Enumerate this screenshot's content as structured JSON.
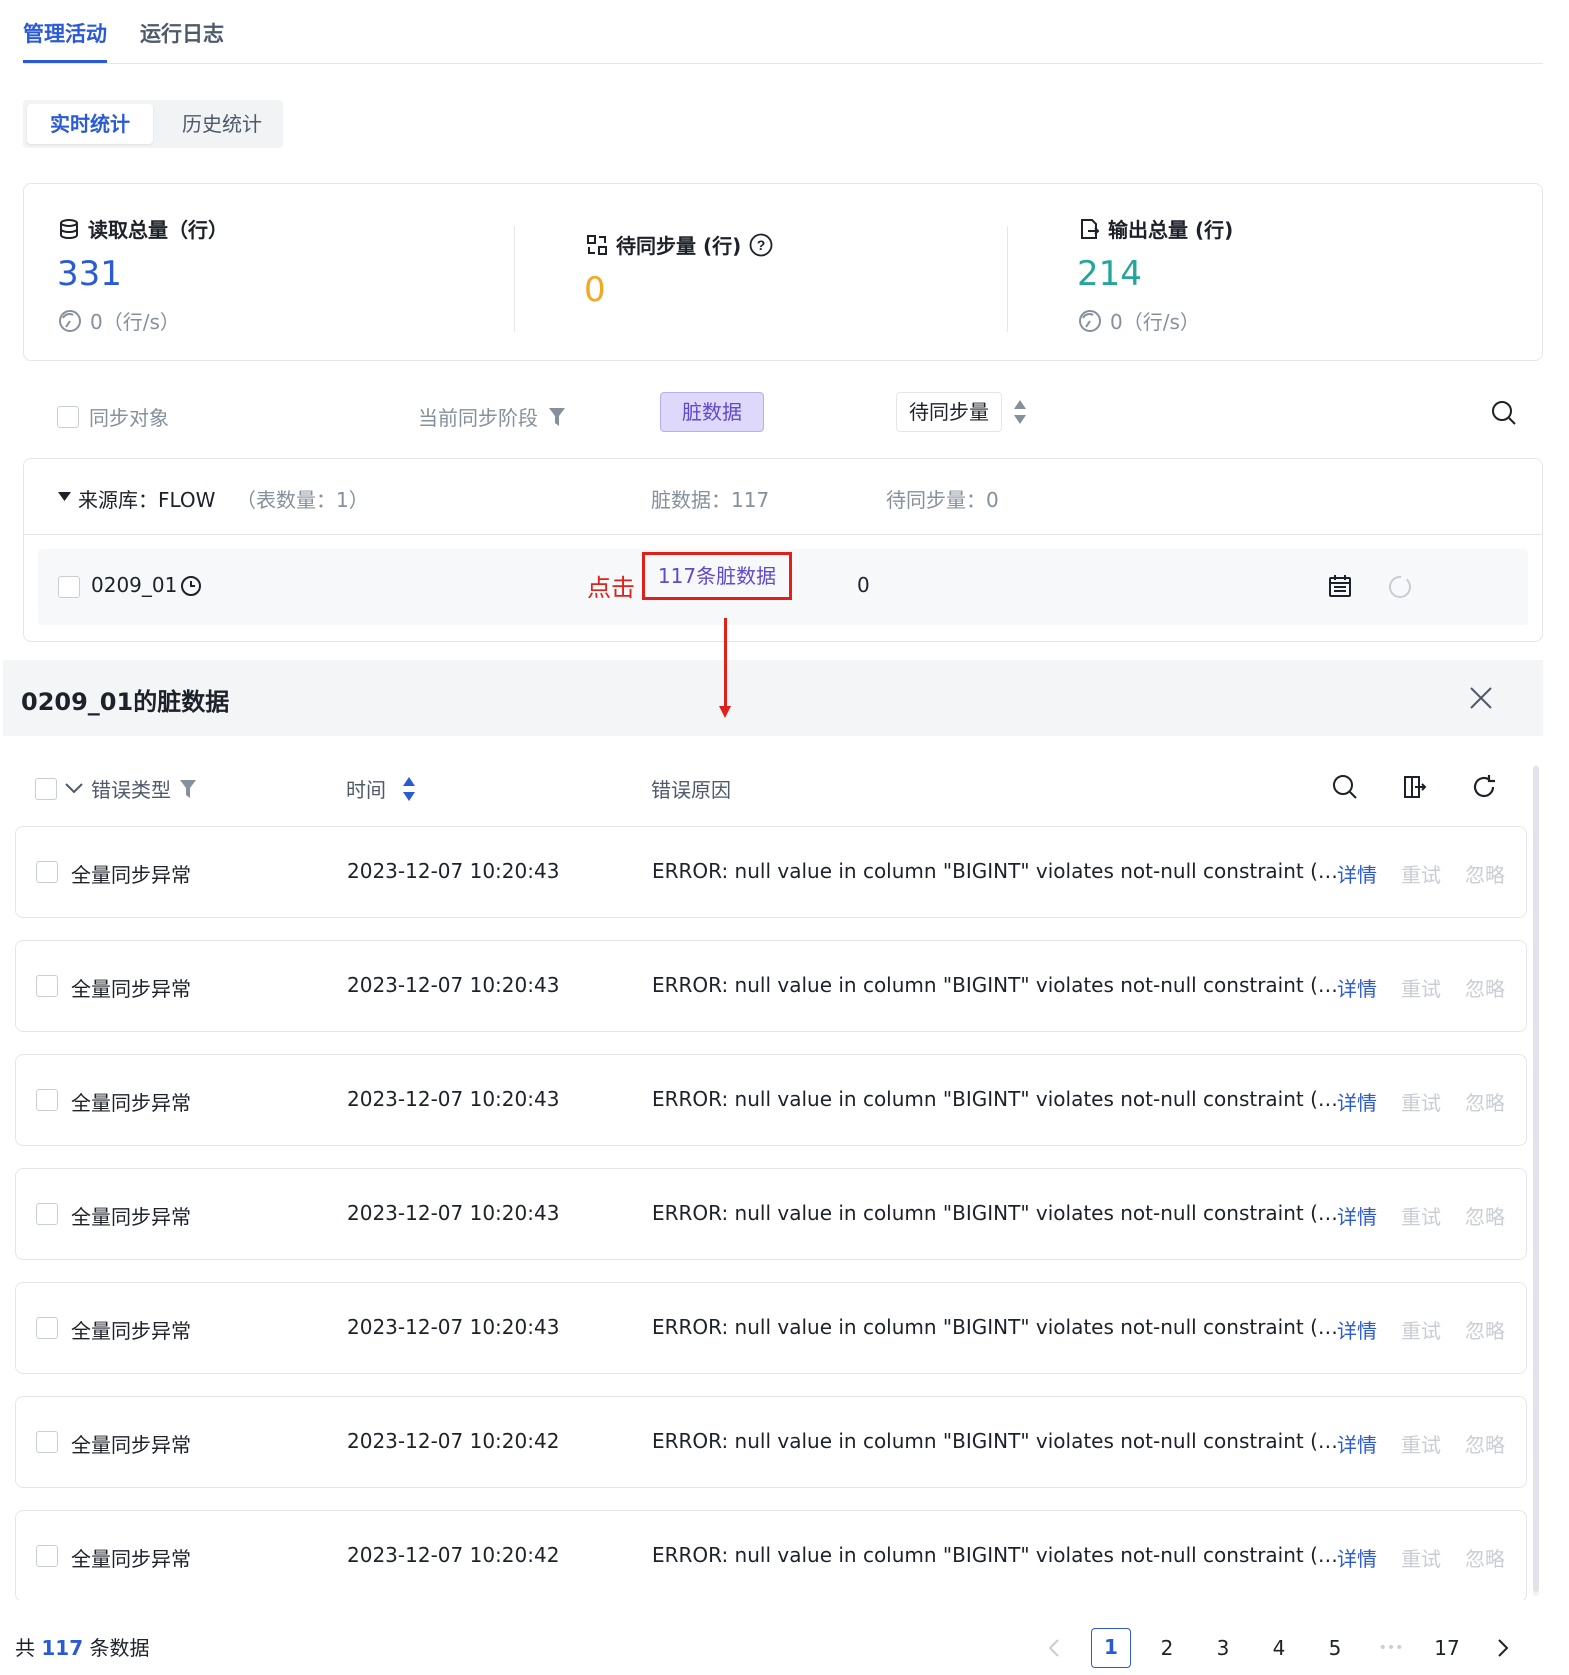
{
  "tabs": [
    {
      "label": "管理活动",
      "active": true
    },
    {
      "label": "运行日志",
      "active": false
    }
  ],
  "segmented": [
    {
      "label": "实时统计",
      "active": true
    },
    {
      "label": "历史统计",
      "active": false
    }
  ],
  "stats": {
    "read": {
      "title": "读取总量（行）",
      "value": "331",
      "rate": "0（行/s）",
      "icon": "database-icon",
      "color": "#2b5ad6"
    },
    "pending": {
      "title": "待同步量 (行)",
      "value": "0",
      "icon": "sync-grid-icon",
      "color": "#f5a623"
    },
    "output": {
      "title": "输出总量 (行)",
      "value": "214",
      "rate": "0（行/s）",
      "icon": "export-file-icon",
      "color": "#26a69a"
    }
  },
  "filter_bar": {
    "sync_object": "同步对象",
    "current_stage": "当前同步阶段",
    "dirty_data": "脏数据",
    "pending_amount": "待同步量"
  },
  "group": {
    "source_label": "来源库：FLOW",
    "table_count": "（表数量：1）",
    "dirty_summary": "脏数据：117",
    "pending_summary": "待同步量：0",
    "row": {
      "table_name": "0209_01",
      "click_hint": "点击",
      "dirty_link": "117条脏数据",
      "pending": "0"
    }
  },
  "drawer": {
    "title": "0209_01的脏数据",
    "columns": {
      "error_type": "错误类型",
      "time": "时间",
      "reason": "错误原因"
    },
    "actions": {
      "detail": "详情",
      "retry": "重试",
      "ignore": "忽略"
    },
    "rows": [
      {
        "type": "全量同步异常",
        "time": "2023-12-07 10:20:43",
        "reason": "ERROR: null value in column \"BIGINT\" violates not-null constraint (…"
      },
      {
        "type": "全量同步异常",
        "time": "2023-12-07 10:20:43",
        "reason": "ERROR: null value in column \"BIGINT\" violates not-null constraint (…"
      },
      {
        "type": "全量同步异常",
        "time": "2023-12-07 10:20:43",
        "reason": "ERROR: null value in column \"BIGINT\" violates not-null constraint (…"
      },
      {
        "type": "全量同步异常",
        "time": "2023-12-07 10:20:43",
        "reason": "ERROR: null value in column \"BIGINT\" violates not-null constraint (…"
      },
      {
        "type": "全量同步异常",
        "time": "2023-12-07 10:20:43",
        "reason": "ERROR: null value in column \"BIGINT\" violates not-null constraint (…"
      },
      {
        "type": "全量同步异常",
        "time": "2023-12-07 10:20:42",
        "reason": "ERROR: null value in column \"BIGINT\" violates not-null constraint (…"
      },
      {
        "type": "全量同步异常",
        "time": "2023-12-07 10:20:42",
        "reason": "ERROR: null value in column \"BIGINT\" violates not-null constraint (…"
      }
    ]
  },
  "pagination": {
    "total_prefix": "共",
    "total": "117",
    "total_suffix": "条数据",
    "pages": [
      "1",
      "2",
      "3",
      "4",
      "5"
    ],
    "ellipsis": "•••",
    "last_page": "17",
    "current": "1"
  }
}
